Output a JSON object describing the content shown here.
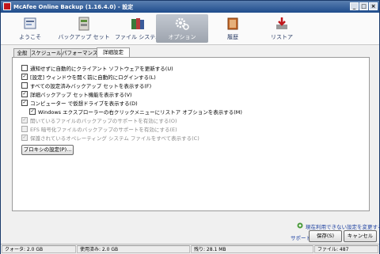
{
  "window": {
    "title": "McAfee Online Backup (1.16.4.0) - 設定"
  },
  "toolbar": {
    "items": [
      {
        "label": "ようこそ",
        "icon": "home-icon"
      },
      {
        "label": "バックアップ セット",
        "icon": "folder-icon"
      },
      {
        "label": "ファイル システム",
        "icon": "file-system-icon"
      },
      {
        "label": "オプション",
        "icon": "gear-icon",
        "active": true
      },
      {
        "label": "履歴",
        "icon": "book-icon"
      },
      {
        "label": "リストア",
        "icon": "restore-icon"
      }
    ]
  },
  "tabs": [
    "全般",
    "スケジュール",
    "パフォーマンス",
    "詳細設定"
  ],
  "options": [
    {
      "label": "通知せずに自動的にクライアント ソフトウェアを更新する(U)",
      "checked": false,
      "disabled": false
    },
    {
      "label": "[設定] ウィンドウを開く前に自動的にログインする(L)",
      "checked": true,
      "disabled": false
    },
    {
      "label": "すべての設定済みバックアップ セットを表示する(F)",
      "checked": false,
      "disabled": false
    },
    {
      "label": "詳細バックアップ セット機能を表示する(V)",
      "checked": true,
      "disabled": false
    },
    {
      "label": "コンピューター で仮想ドライブを表示する(D)",
      "checked": true,
      "disabled": false
    },
    {
      "label": "Windows エクスプローラーの右クリックメニューにリストア オプションを表示する(M)",
      "checked": true,
      "disabled": false
    },
    {
      "label": "開いているファイルのバックアップのサポートを有効にする(O)",
      "checked": true,
      "disabled": true
    },
    {
      "label": "EFS 暗号化ファイルのバックアップのサポートを有効にする(E)",
      "checked": false,
      "disabled": true
    },
    {
      "label": "保護されているオペレーティング システム ファイルをすべて表示する(C)",
      "checked": true,
      "disabled": true
    }
  ],
  "proxy_button": "プロキシの設定(P)...",
  "footer": {
    "unavailable_link": "現在利用できない設定を変更する",
    "support_link": "サポート",
    "save_button": "保存(S)",
    "cancel_button": "キャンセル"
  },
  "status": {
    "quota": "クォータ: 2.0 GB",
    "used": "使用済み: 2.0 GB",
    "remaining": "残り: 28.1 MB",
    "files": "ファイル: 487"
  },
  "colors": {
    "title_bar": "#1f4c8c",
    "link": "#1b3fa0",
    "brand_red": "#c0161b"
  }
}
